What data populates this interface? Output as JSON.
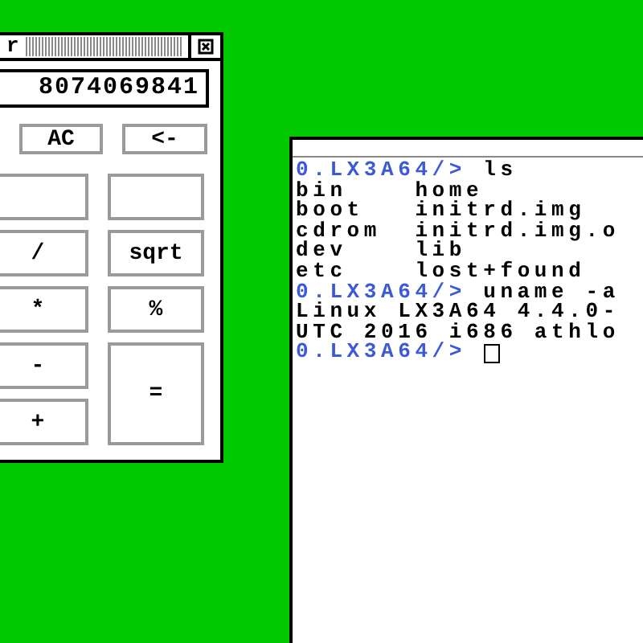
{
  "calculator": {
    "title": "r",
    "display": "8074069841",
    "top_keys": [
      "AC",
      "<-"
    ],
    "keys": [
      {
        "kind": "blank"
      },
      {
        "kind": "blank"
      },
      {
        "kind": "key",
        "label": "/"
      },
      {
        "kind": "key",
        "label": "sqrt"
      },
      {
        "kind": "key",
        "label": "*"
      },
      {
        "kind": "key",
        "label": "%"
      },
      {
        "kind": "key",
        "label": "-"
      },
      {
        "kind": "tall",
        "label": "="
      },
      {
        "kind": "key",
        "label": "+"
      }
    ]
  },
  "terminal": {
    "lines": [
      {
        "kind": "prompt",
        "prompt": "0.LX3A64/>",
        "command": "ls"
      },
      {
        "kind": "output",
        "text": "bin    home"
      },
      {
        "kind": "output",
        "text": "boot   initrd.img"
      },
      {
        "kind": "output",
        "text": "cdrom  initrd.img.o"
      },
      {
        "kind": "output",
        "text": "dev    lib"
      },
      {
        "kind": "output",
        "text": "etc    lost+found"
      },
      {
        "kind": "prompt",
        "prompt": "0.LX3A64/>",
        "command": "uname -a"
      },
      {
        "kind": "output",
        "text": "Linux LX3A64 4.4.0-"
      },
      {
        "kind": "output",
        "text": "UTC 2016 i686 athlo"
      },
      {
        "kind": "prompt",
        "prompt": "0.LX3A64/>",
        "cursor": true
      }
    ]
  }
}
